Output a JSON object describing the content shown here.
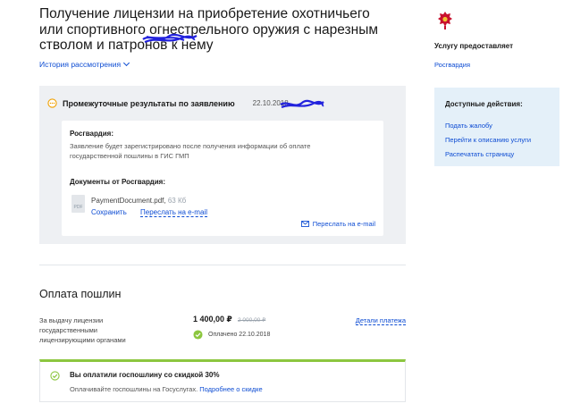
{
  "service": {
    "title": "Получение лицензии на приобретение охотничьего или спортивного огнестрельного оружия с нарезным стволом и патронов к нему",
    "history_label": "История рассмотрения"
  },
  "intermediate": {
    "title": "Промежуточные результаты по заявлению",
    "date": "22.10.2018",
    "org_label": "Росгвардия:",
    "message": "Заявление будет зарегистрировано после получения информации об оплате государственной пошлины в ГИС ГМП",
    "docs_label": "Документы от Росгвардия:",
    "file_type": "PDF",
    "file_name": "PaymentDocument.pdf,",
    "file_size": "63 Кб",
    "save_label": "Сохранить",
    "forward_email_label": "Переслать на e-mail",
    "forward_email_right_label": "Переслать на e-mail"
  },
  "fees": {
    "title": "Оплата пошлин",
    "description": "За выдачу лицензии государственными лицензирующими органами",
    "amount": "1 400,00 ₽",
    "old_amount": "2 000,00 ₽",
    "details_label": "Детали платежа",
    "paid_status": "Оплачено 22.10.2018"
  },
  "discount": {
    "title": "Вы оплатили госпошлину со скидкой 30%",
    "text": "Оплачивайте госпошлины на Госуслугах.",
    "more_label": "Подробнее о скидке"
  },
  "provider": {
    "label": "Услугу предоставляет",
    "name": "Росгвардия"
  },
  "actions": {
    "title": "Доступные действия:",
    "items": [
      {
        "label": "Подать жалобу"
      },
      {
        "label": "Перейти к описанию услуги"
      },
      {
        "label": "Распечатать страницу"
      }
    ]
  },
  "colors": {
    "link": "#0d4cd3",
    "accent_green": "#8cc63f",
    "panel_gray": "#eef0f3",
    "panel_blue": "#e4f0f9",
    "scribble": "#2222dd",
    "warning_orange": "#f0a000"
  },
  "icons": [
    "clock-icon",
    "chevron-down-icon",
    "pdf-file-icon",
    "mail-icon",
    "check-circle-icon",
    "emblem-icon"
  ]
}
